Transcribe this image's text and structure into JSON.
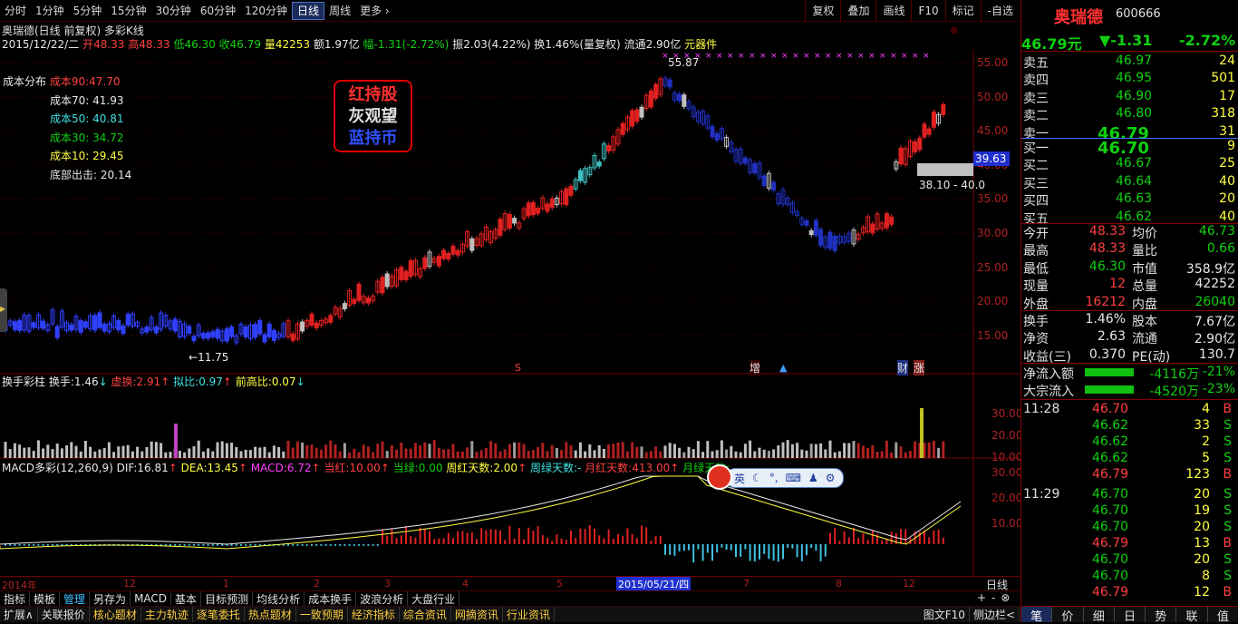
{
  "periods": [
    "分时",
    "1分钟",
    "5分钟",
    "15分钟",
    "30分钟",
    "60分钟",
    "120分钟",
    "日线",
    "周线",
    "更多 ›"
  ],
  "active_period": "日线",
  "top_buttons": [
    "复权",
    "叠加",
    "画线",
    "F10",
    "标记",
    "-自选"
  ],
  "chart_title": "奥瑞德(日线 前复权) 多彩K线",
  "quote_line": {
    "date": "2015/12/22/二",
    "open_label": "开",
    "open": "48.33",
    "high_label": "高",
    "high": "48.33",
    "low_label": "低",
    "low": "46.30",
    "close_label": "收",
    "close": "46.79",
    "vol_label": "量",
    "vol": "42253",
    "amt_label": "额",
    "amt": "1.97亿",
    "chg_label": "幅",
    "chg": "-1.31(-2.72%)",
    "amp_label": "振",
    "amp": "2.03(4.22%)",
    "turn_label": "换",
    "turn": "1.46%(量复权)",
    "float_label": "流通",
    "float": "2.90亿",
    "sector": "元器件"
  },
  "cost": {
    "title": "成本分布",
    "c90_label": "成本90:",
    "c90": "47.70",
    "c70_label": "成本70:",
    "c70": "41.93",
    "c50_label": "成本50:",
    "c50": "40.81",
    "c30_label": "成本30:",
    "c30": "34.72",
    "c10_label": "成本10:",
    "c10": "29.45",
    "bottom_label": "底部出击:",
    "bottom": "20.14"
  },
  "legend": {
    "l1": "红持股",
    "l2": "灰观望",
    "l3": "蓝持币"
  },
  "price_axis": [
    "55.00",
    "50.00",
    "45.00",
    "40.00",
    "35.00",
    "30.00",
    "25.00",
    "20.00",
    "15.00"
  ],
  "price_marks": {
    "high": "55.87",
    "low": "11.75",
    "cross": "39.63",
    "range": "38.10 - 40.0"
  },
  "events": {
    "s": "S",
    "zeng": "增",
    "cai": "财",
    "zhang": "涨"
  },
  "sub1": {
    "title": "换手彩柱",
    "turn_label": "换手:",
    "turn": "1.46",
    "xu_label": "虚换:",
    "xu": "2.91",
    "ni_label": "拟比:",
    "ni": "0.97",
    "qian_label": "前高比:",
    "qian": "0.07"
  },
  "sub1_axis": [
    "30.00",
    "20.00",
    "10.00"
  ],
  "sub2": {
    "title": "MACD多彩(12,260,9)",
    "dif_label": "DIF:",
    "dif": "16.81",
    "dea_label": "DEA:",
    "dea": "13.45",
    "macd_label": "MACD:",
    "macd": "6.72",
    "dh_label": "当红:",
    "dh": "10.00",
    "dl_label": "当绿:",
    "dl": "0.00",
    "zh_label": "周红天数:",
    "zh": "2.00",
    "zl_label": "周绿天数:",
    "zl": "-",
    "yh_label": "月红天数:",
    "yh": "413.00",
    "yl_label": "月绿天数:",
    "yl": "..."
  },
  "sub2_axis": [
    "30.00",
    "20.00",
    "10.00"
  ],
  "time_axis": {
    "year": "2014年",
    "m12": "12",
    "m1": "1",
    "m2": "2",
    "m3": "3",
    "m4": "4",
    "m5": "5",
    "cursor_date": "2015/05/21/四",
    "m7": "7",
    "m8": "8",
    "m12b": "12",
    "period": "日线"
  },
  "tabs1": [
    "指标",
    "模板",
    "管理",
    "另存为",
    "MACD",
    "基本",
    "目标预测",
    "均线分析",
    "成本换手",
    "波浪分析",
    "大盘行业"
  ],
  "tabs1_active": "管理",
  "tabs2": [
    {
      "t": "扩展∧",
      "c": "#e0e0e0"
    },
    {
      "t": "关联报价",
      "c": "#e0e0e0"
    },
    {
      "t": "核心题材",
      "c": "#ffd040"
    },
    {
      "t": "主力轨迹",
      "c": "#ffd040"
    },
    {
      "t": "逐笔委托",
      "c": "#ffd040"
    },
    {
      "t": "热点题材",
      "c": "#ffd040"
    },
    {
      "t": "一致预期",
      "c": "#ffd040"
    },
    {
      "t": "经济指标",
      "c": "#ffd040"
    },
    {
      "t": "综合资讯",
      "c": "#ffd040"
    },
    {
      "t": "网摘资讯",
      "c": "#ffd040"
    },
    {
      "t": "行业资讯",
      "c": "#ffd040"
    }
  ],
  "tabs2_right": {
    "f10": "图文F10",
    "side": "侧边栏<"
  },
  "stock": {
    "name": "奥瑞德",
    "code": "600666",
    "price": "46.79元",
    "chg": "▼-1.31",
    "pct": "-2.72%"
  },
  "sell": [
    {
      "l": "卖五",
      "p": "46.97",
      "v": "24"
    },
    {
      "l": "卖四",
      "p": "46.95",
      "v": "501"
    },
    {
      "l": "卖三",
      "p": "46.90",
      "v": "17"
    },
    {
      "l": "卖二",
      "p": "46.80",
      "v": "318"
    },
    {
      "l": "卖一",
      "p": "46.79",
      "v": "31"
    }
  ],
  "buy": [
    {
      "l": "买一",
      "p": "46.70",
      "v": "9"
    },
    {
      "l": "买二",
      "p": "46.67",
      "v": "25"
    },
    {
      "l": "买三",
      "p": "46.64",
      "v": "40"
    },
    {
      "l": "买四",
      "p": "46.63",
      "v": "20"
    },
    {
      "l": "买五",
      "p": "46.62",
      "v": "40"
    }
  ],
  "stats": [
    {
      "a": "今开",
      "b": "48.33",
      "bc": "#ff4040",
      "c": "均价",
      "d": "46.73",
      "dc": "#10d010"
    },
    {
      "a": "最高",
      "b": "48.33",
      "bc": "#ff4040",
      "c": "量比",
      "d": "0.66",
      "dc": "#10d010"
    },
    {
      "a": "最低",
      "b": "46.30",
      "bc": "#10d010",
      "c": "市值",
      "d": "358.9亿",
      "dc": "#e8e8e8"
    },
    {
      "a": "现量",
      "b": "12",
      "bc": "#ff4040",
      "c": "总量",
      "d": "42252",
      "dc": "#e8e8e8"
    },
    {
      "a": "外盘",
      "b": "16212",
      "bc": "#ff4040",
      "c": "内盘",
      "d": "26040",
      "dc": "#10d010"
    }
  ],
  "stats2": [
    {
      "a": "换手",
      "b": "1.46%",
      "c": "股本",
      "d": "7.67亿"
    },
    {
      "a": "净资",
      "b": "2.63",
      "c": "流通",
      "d": "2.90亿"
    },
    {
      "a": "收益(三)",
      "b": "0.370",
      "c": "PE(动)",
      "d": "130.7"
    }
  ],
  "flow": [
    {
      "l": "净流入额",
      "v": "-4116万",
      "p": "-21%"
    },
    {
      "l": "大宗流入",
      "v": "-4520万",
      "p": "-23%"
    }
  ],
  "ticks": [
    {
      "t": "11:28",
      "p": "46.70",
      "v": "4",
      "s": "B"
    },
    {
      "t": "",
      "p": "46.62",
      "v": "33",
      "s": "S"
    },
    {
      "t": "",
      "p": "46.62",
      "v": "2",
      "s": "S"
    },
    {
      "t": "",
      "p": "46.62",
      "v": "5",
      "s": "S"
    },
    {
      "t": "",
      "p": "46.79",
      "v": "123",
      "s": "B"
    },
    {
      "t": "11:29",
      "p": "46.70",
      "v": "20",
      "s": "S"
    },
    {
      "t": "",
      "p": "46.70",
      "v": "19",
      "s": "S"
    },
    {
      "t": "",
      "p": "46.70",
      "v": "20",
      "s": "S"
    },
    {
      "t": "",
      "p": "46.79",
      "v": "13",
      "s": "B"
    },
    {
      "t": "",
      "p": "46.70",
      "v": "20",
      "s": "S"
    },
    {
      "t": "",
      "p": "46.70",
      "v": "8",
      "s": "S"
    },
    {
      "t": "",
      "p": "46.79",
      "v": "12",
      "s": "B"
    }
  ],
  "rptabs": [
    "笔",
    "价",
    "细",
    "日",
    "势",
    "联",
    "值"
  ],
  "ime": {
    "lang": "英"
  }
}
